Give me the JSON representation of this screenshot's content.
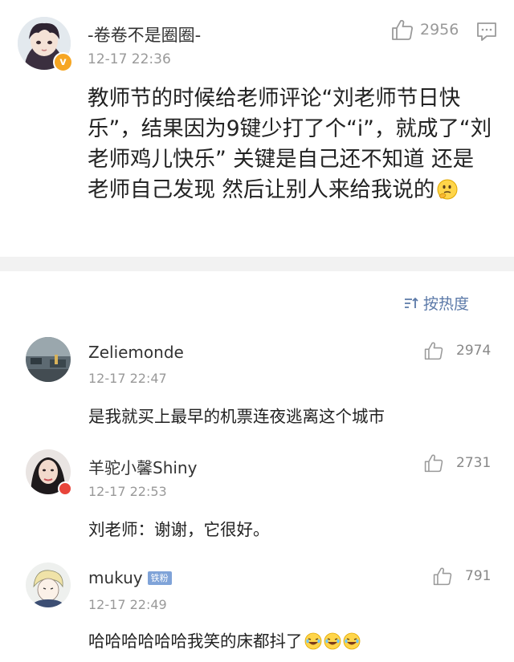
{
  "post": {
    "username": "-卷卷不是圈圈-",
    "time": "12-17 22:36",
    "like_count": "2956",
    "text": "教师节的时候给老师评论“刘老师节日快乐”，结果因为9键少打了个“i”，就成了“刘老师鸡儿快乐” 关键是自己还不知道 还是老师自己发现 然后让别人来给我说的",
    "verified_badge": "v"
  },
  "sort": {
    "label": "按热度",
    "icon": "sort-icon"
  },
  "comments": [
    {
      "username": "Zeliemonde",
      "time": "12-17 22:47",
      "text": "是我就买上最早的机票连夜逃离这个城市",
      "like_count": "2974"
    },
    {
      "username": "羊驼小馨Shiny",
      "time": "12-17 22:53",
      "text": "刘老师：谢谢，它很好。",
      "like_count": "2731"
    },
    {
      "username": "mukuy",
      "fan_badge": "铁粉",
      "time": "12-17 22:49",
      "text": "哈哈哈哈哈哈我笑的床都抖了",
      "like_count": "791"
    }
  ],
  "colors": {
    "link_blue": "#5b79a8",
    "verified_orange": "#f6a623",
    "fan_badge_blue": "#7fa3d8",
    "divider_gray": "#f2f2f2"
  }
}
